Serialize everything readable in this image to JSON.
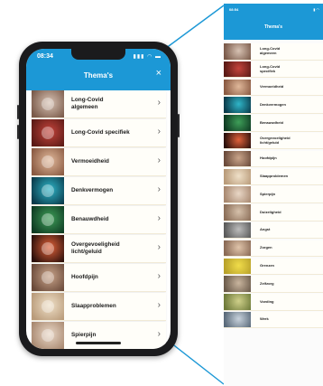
{
  "phone": {
    "status_time": "08:34",
    "status_icons": "▮▮▮ ◠ ▬",
    "title": "Thema's",
    "close_icon": "×",
    "items": [
      {
        "label": "Long-Covid algemeen",
        "duration": "",
        "colors": [
          "#7a5a4a",
          "#d7c2b3"
        ]
      },
      {
        "label": "Long-Covid specifiek",
        "duration": "",
        "colors": [
          "#5a1a15",
          "#c4443c"
        ]
      },
      {
        "label": "Vermoeidheid",
        "duration": "",
        "colors": [
          "#8a5a42",
          "#e0b89a"
        ]
      },
      {
        "label": "Denkvermogen",
        "duration": "",
        "colors": [
          "#0a3a4a",
          "#2fb5c8"
        ]
      },
      {
        "label": "Benauwdheid",
        "duration": "",
        "colors": [
          "#0e3a22",
          "#3e9e58"
        ]
      },
      {
        "label": "Overgevoeligheid licht/geluid",
        "duration": "",
        "colors": [
          "#2a0f0a",
          "#e0623a"
        ]
      },
      {
        "label": "Hoofdpijn",
        "duration": "",
        "colors": [
          "#6a4a3a",
          "#c9a48a"
        ]
      },
      {
        "label": "Slaapproblemen",
        "duration": "",
        "colors": [
          "#b99b7a",
          "#efe0c8"
        ]
      },
      {
        "label": "Spierpijn",
        "duration": "",
        "colors": [
          "#a88870",
          "#e9d7c6"
        ]
      }
    ]
  },
  "zoom": {
    "status_time": "08:54",
    "status_icons": "▮ ◠",
    "title": "Thema's",
    "items": [
      {
        "label": "Long-Covid algemeen",
        "colors": [
          "#7a5a4a",
          "#d7c2b3"
        ]
      },
      {
        "label": "Long-Covid specifiek",
        "colors": [
          "#5a1a15",
          "#c4443c"
        ]
      },
      {
        "label": "Vermoeidheid",
        "colors": [
          "#8a5a42",
          "#e0b89a"
        ]
      },
      {
        "label": "Denkvermogen",
        "colors": [
          "#0a3a4a",
          "#2fb5c8"
        ]
      },
      {
        "label": "Benauwdheid",
        "colors": [
          "#0e3a22",
          "#3e9e58"
        ]
      },
      {
        "label": "Overgevoeligheid licht/geluid",
        "colors": [
          "#2a0f0a",
          "#e0623a"
        ]
      },
      {
        "label": "Hoofdpijn",
        "colors": [
          "#6a4a3a",
          "#c9a48a"
        ]
      },
      {
        "label": "Slaapproblemen",
        "colors": [
          "#b99b7a",
          "#efe0c8"
        ]
      },
      {
        "label": "Spierpijn",
        "colors": [
          "#a88870",
          "#e9d7c6"
        ]
      },
      {
        "label": "Duizeligheid",
        "colors": [
          "#8b6e58",
          "#d6c1ab"
        ]
      },
      {
        "label": "Angst",
        "colors": [
          "#5a5a5a",
          "#bcbcbc"
        ]
      },
      {
        "label": "Zorgen",
        "colors": [
          "#8a6a55",
          "#e0c4aa"
        ]
      },
      {
        "label": "Grenzen",
        "colors": [
          "#b8a12a",
          "#f0dc4a"
        ]
      },
      {
        "label": "Zelfzorg",
        "colors": [
          "#6a5a4a",
          "#c9b59e"
        ]
      },
      {
        "label": "Voeding",
        "colors": [
          "#6e7a3a",
          "#cfd08a"
        ]
      },
      {
        "label": "Werk",
        "colors": [
          "#5a6a7a",
          "#c8d2dc"
        ]
      }
    ]
  },
  "colors": {
    "accent": "#1c98d6",
    "row_bg": "#fffef9",
    "phone_body": "#1b1b1d"
  }
}
